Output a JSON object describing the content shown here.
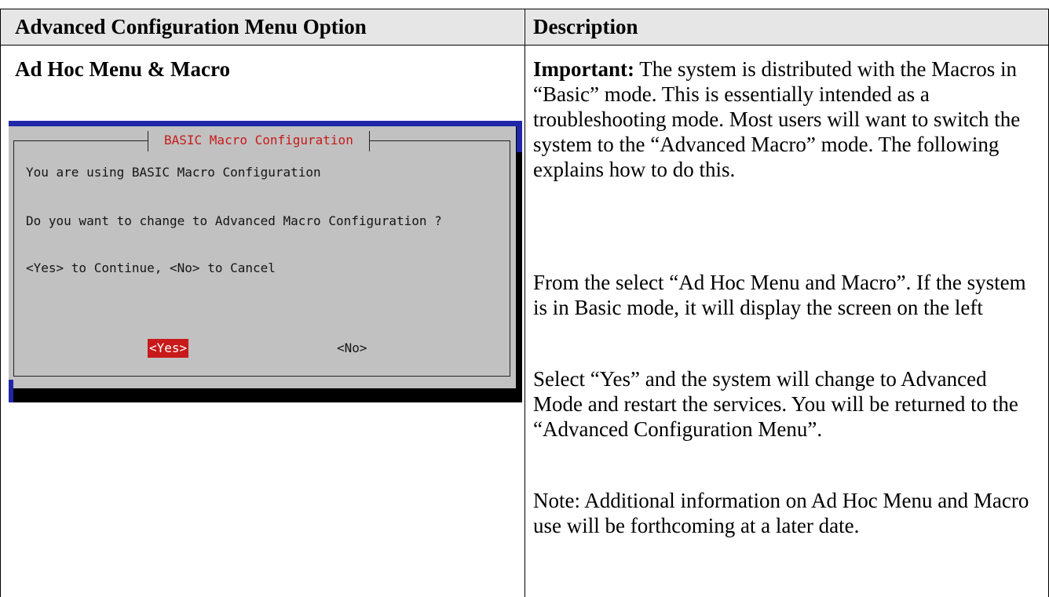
{
  "table": {
    "headers": {
      "option": "Advanced Configuration Menu Option",
      "description": "Description"
    },
    "row": {
      "option_title": "Ad Hoc Menu & Macro",
      "terminal_dialog": {
        "title": "BASIC Macro Configuration",
        "line1": "You are using BASIC Macro Configuration",
        "line2": "Do you want to change to Advanced Macro Configuration ?",
        "line3": "<Yes> to Continue, <No> to Cancel",
        "yes_button": "<Yes>",
        "no_button": "<No>"
      },
      "description": {
        "important_label": "Important:",
        "important_text": " The system is distributed with the Macros in “Basic” mode.  This is essentially intended as a troubleshooting mode.  Most users will want to switch the system to the “Advanced Macro” mode.  The following explains how to do this.",
        "para2": "From the  select “Ad Hoc Menu and Macro”.  If the system is in Basic mode, it will display the screen on the left",
        "para3": "Select “Yes”  and the system will change to Advanced Mode and restart the services.  You will be returned to the “Advanced Configuration Menu”.",
        "para4": "Note:  Additional information on Ad Hoc Menu and Macro use will be forthcoming at a later date."
      }
    }
  },
  "colors": {
    "header_bg": "#e6e6e6",
    "terminal_bg": "#c1c1c1",
    "terminal_accent": "#c81a1a",
    "terminal_border_blue": "#1f27a8"
  }
}
